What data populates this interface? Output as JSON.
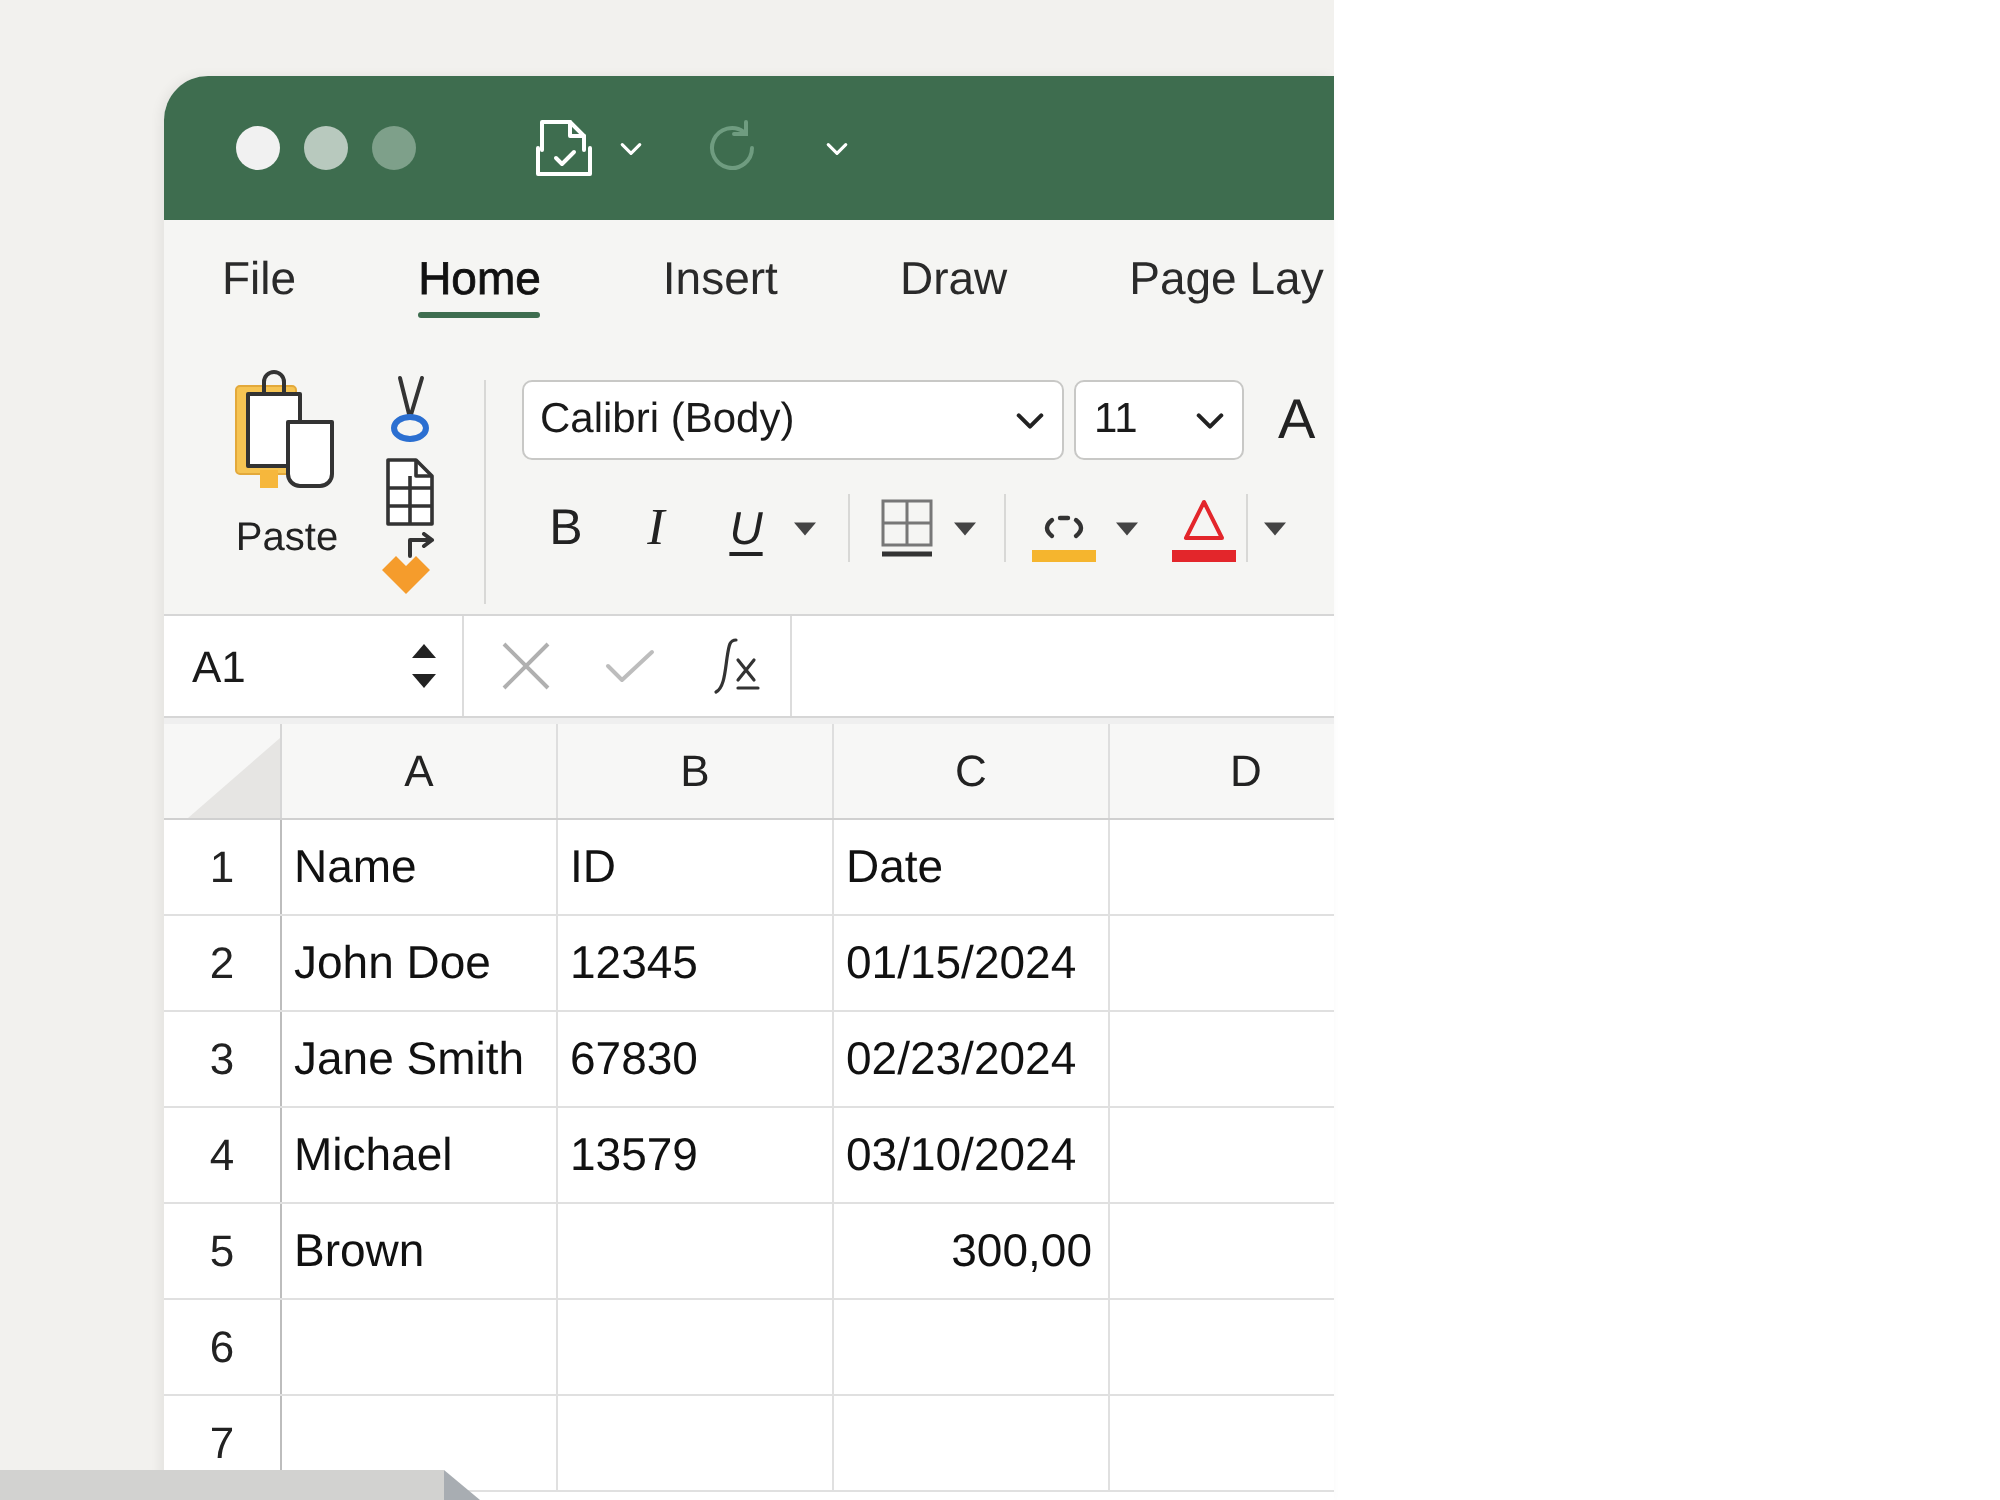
{
  "ribbon_tabs": [
    {
      "label": "File",
      "selected": false
    },
    {
      "label": "Home",
      "selected": true
    },
    {
      "label": "Insert",
      "selected": false
    },
    {
      "label": "Draw",
      "selected": false
    },
    {
      "label": "Page Lay",
      "selected": false
    }
  ],
  "clipboard": {
    "paste_label": "Paste"
  },
  "font": {
    "name": "Calibri (Body)",
    "size": "11",
    "grow_label": "A",
    "styles": [
      {
        "kind": "bold",
        "label": "B"
      },
      {
        "kind": "italic",
        "label": "I"
      },
      {
        "kind": "underline",
        "label": "U"
      }
    ],
    "colors": [
      {
        "kind": "fill",
        "color": "#f5b52e"
      },
      {
        "kind": "font",
        "color": "#e3262b"
      }
    ]
  },
  "formula_bar": {
    "name_box": "A1"
  },
  "sheet": {
    "columns": [
      "A",
      "B",
      "C",
      "D"
    ],
    "rows": [
      {
        "number": "1",
        "cells": [
          {
            "kind": "text",
            "text": "Name"
          },
          {
            "kind": "text",
            "text": "ID"
          },
          {
            "kind": "text",
            "text": "Date"
          }
        ]
      },
      {
        "number": "2",
        "cells": [
          {
            "kind": "text",
            "text": "John Doe"
          },
          {
            "kind": "text",
            "text": "12345"
          },
          {
            "kind": "text",
            "text": "01/15/2024"
          }
        ]
      },
      {
        "number": "3",
        "cells": [
          {
            "kind": "text",
            "text": "Jane Smith"
          },
          {
            "kind": "text",
            "text": "67830"
          },
          {
            "kind": "text",
            "text": "02/23/2024"
          }
        ]
      },
      {
        "number": "4",
        "cells": [
          {
            "kind": "text",
            "text": "Michael"
          },
          {
            "kind": "text",
            "text": "13579"
          },
          {
            "kind": "text",
            "text": "03/10/2024"
          }
        ]
      },
      {
        "number": "5",
        "cells": [
          {
            "kind": "text",
            "text": "Brown"
          },
          null,
          {
            "kind": "number",
            "text": "300,00"
          }
        ]
      },
      {
        "number": "6"
      },
      {
        "number": "7"
      }
    ]
  }
}
